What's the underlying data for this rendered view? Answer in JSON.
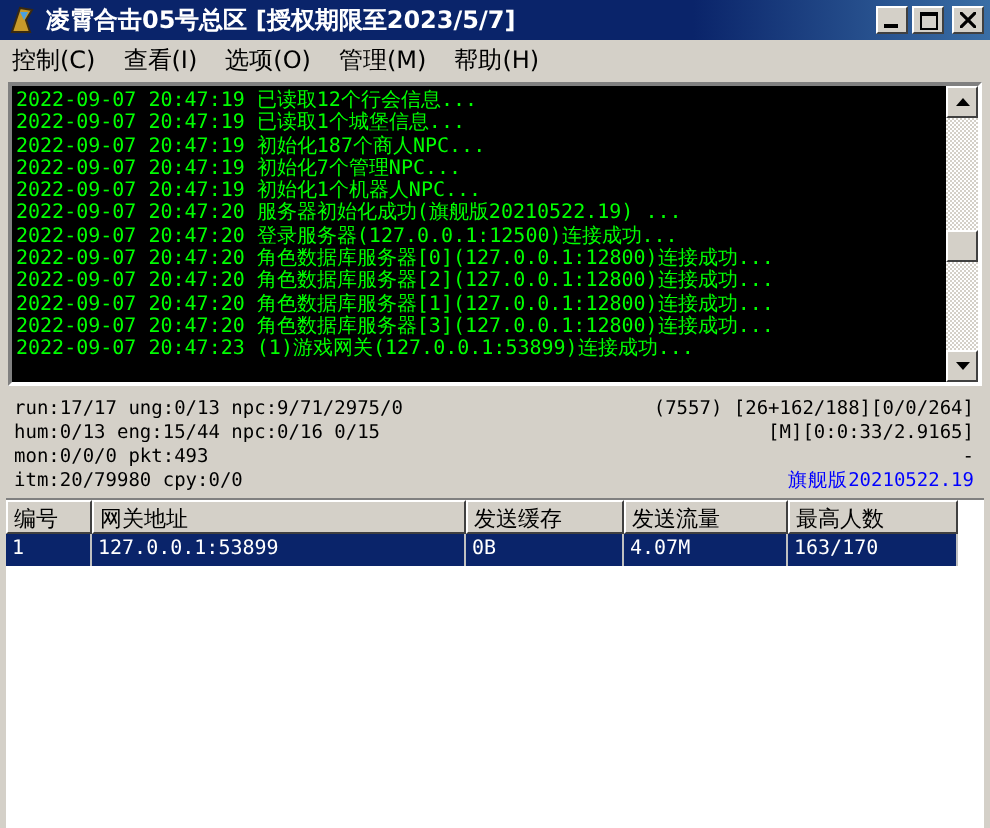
{
  "window": {
    "title": "凌霄合击05号总区 [授权期限至2023/5/7]"
  },
  "menu": [
    {
      "label": "控制(C)"
    },
    {
      "label": "查看(I)"
    },
    {
      "label": "选项(O)"
    },
    {
      "label": "管理(M)"
    },
    {
      "label": "帮助(H)"
    }
  ],
  "log": [
    "2022-09-07 20:47:19 已读取12个行会信息...",
    "2022-09-07 20:47:19 已读取1个城堡信息...",
    "2022-09-07 20:47:19 初始化187个商人NPC...",
    "2022-09-07 20:47:19 初始化7个管理NPC...",
    "2022-09-07 20:47:19 初始化1个机器人NPC...",
    "2022-09-07 20:47:20 服务器初始化成功(旗舰版20210522.19) ...",
    "2022-09-07 20:47:20 登录服务器(127.0.0.1:12500)连接成功...",
    "2022-09-07 20:47:20 角色数据库服务器[0](127.0.0.1:12800)连接成功...",
    "2022-09-07 20:47:20 角色数据库服务器[2](127.0.0.1:12800)连接成功...",
    "2022-09-07 20:47:20 角色数据库服务器[1](127.0.0.1:12800)连接成功...",
    "2022-09-07 20:47:20 角色数据库服务器[3](127.0.0.1:12800)连接成功...",
    "2022-09-07 20:47:23 (1)游戏网关(127.0.0.1:53899)连接成功..."
  ],
  "status": {
    "left": [
      "run:17/17 ung:0/13 npc:9/71/2975/0",
      "hum:0/13 eng:15/44 npc:0/16 0/15",
      "mon:0/0/0 pkt:493",
      "itm:20/79980 cpy:0/0"
    ],
    "right": [
      "(7557) [26+162/188][0/0/264]",
      "[M][0:0:33/2.9165]",
      "-"
    ],
    "version": "旗舰版20210522.19"
  },
  "table": {
    "columns": [
      "编号",
      "网关地址",
      "发送缓存",
      "发送流量",
      "最高人数"
    ],
    "rows": [
      {
        "selected": true,
        "cells": [
          "1",
          "127.0.0.1:53899",
          "0B",
          "4.07M",
          "163/170"
        ]
      }
    ]
  }
}
